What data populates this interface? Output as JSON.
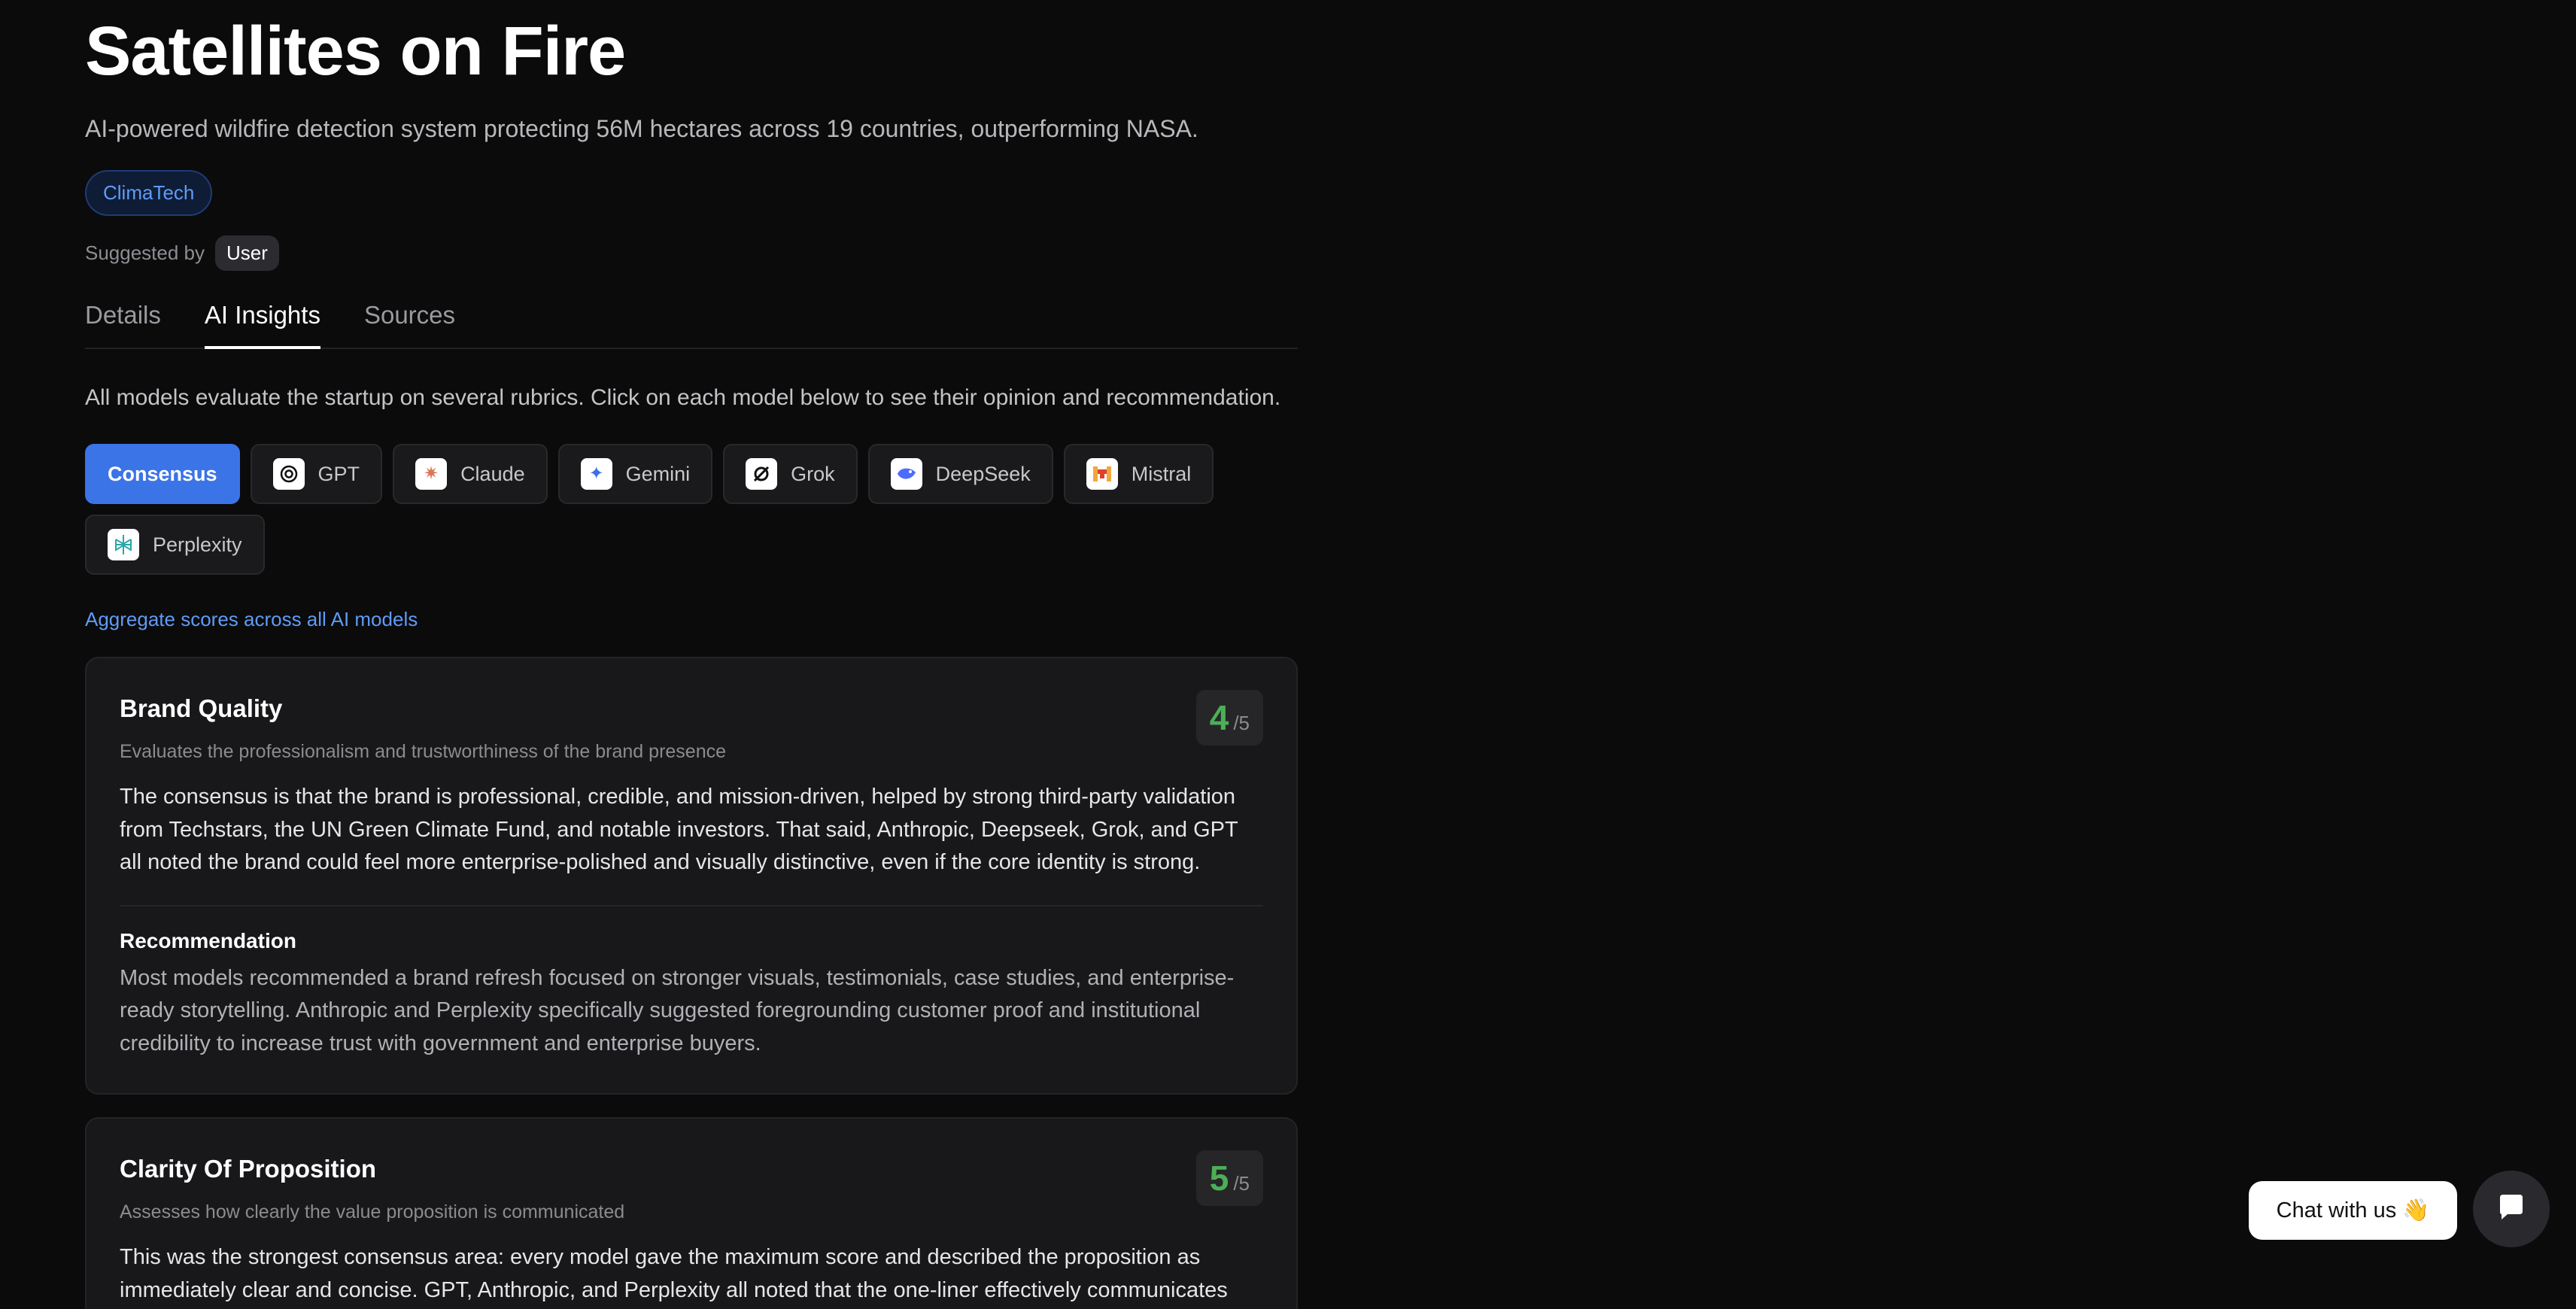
{
  "header": {
    "title": "Satellites on Fire",
    "subtitle": "AI-powered wildfire detection system protecting 56M hectares across 19 countries, outperforming NASA.",
    "tag": "ClimaTech",
    "suggested_by_label": "Suggested by",
    "suggested_by_value": "User"
  },
  "tabs": [
    {
      "label": "Details"
    },
    {
      "label": "AI Insights"
    },
    {
      "label": "Sources"
    }
  ],
  "intro": "All models evaluate the startup on several rubrics. Click on each model below to see their opinion and recommendation.",
  "models": [
    {
      "label": "Consensus",
      "icon": "consensus"
    },
    {
      "label": "GPT",
      "icon": "gpt-icon"
    },
    {
      "label": "Claude",
      "icon": "claude-icon"
    },
    {
      "label": "Gemini",
      "icon": "gemini-icon"
    },
    {
      "label": "Grok",
      "icon": "grok-icon"
    },
    {
      "label": "DeepSeek",
      "icon": "deepseek-icon"
    },
    {
      "label": "Mistral",
      "icon": "mistral-icon"
    },
    {
      "label": "Perplexity",
      "icon": "perplexity-icon"
    }
  ],
  "aggregate_label": "Aggregate scores across all AI models",
  "cards": [
    {
      "title": "Brand Quality",
      "description": "Evaluates the professionalism and trustworthiness of the brand presence",
      "score": "4",
      "score_max": "/5",
      "body": "The consensus is that the brand is professional, credible, and mission-driven, helped by strong third-party validation from Techstars, the UN Green Climate Fund, and notable investors. That said, Anthropic, Deepseek, Grok, and GPT all noted the brand could feel more enterprise-polished and visually distinctive, even if the core identity is strong.",
      "recommendation_label": "Recommendation",
      "recommendation": "Most models recommended a brand refresh focused on stronger visuals, testimonials, case studies, and enterprise-ready storytelling. Anthropic and Perplexity specifically suggested foregrounding customer proof and institutional credibility to increase trust with government and enterprise buyers."
    },
    {
      "title": "Clarity Of Proposition",
      "description": "Assesses how clearly the value proposition is communicated",
      "score": "5",
      "score_max": "/5",
      "body": "This was the strongest consensus area: every model gave the maximum score and described the proposition as immediately clear and concise. GPT, Anthropic, and Perplexity all noted that the one-liner effectively communicates"
    }
  ],
  "chat": {
    "label": "Chat with us 👋"
  },
  "colors": {
    "accent": "#3b74e6",
    "score_green": "#4caf57",
    "link_blue": "#5f9bf7"
  }
}
